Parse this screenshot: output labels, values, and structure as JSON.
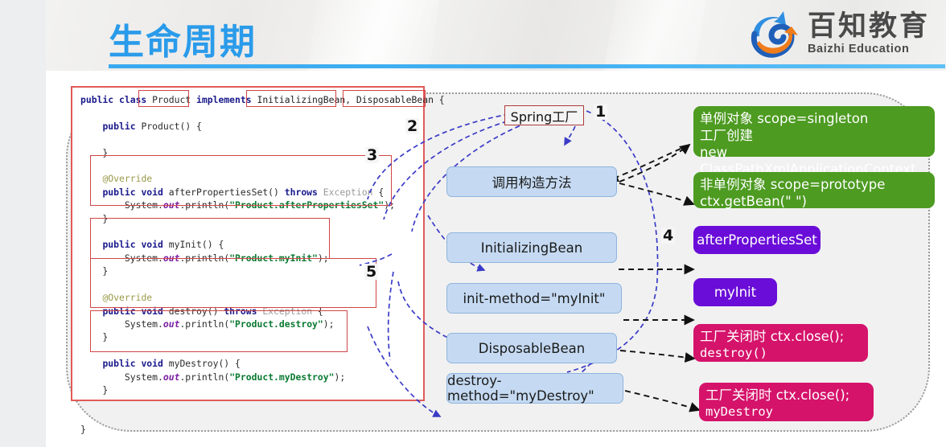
{
  "header": {
    "title": "生命周期",
    "logo": {
      "cn": "百知教育",
      "en": "Baizhi Education",
      "icon": "baizhi-logo-icon"
    },
    "accent_color": "#2a9bea"
  },
  "code_panel": {
    "lines": [
      "public class Product implements InitializingBean, DisposableBean {",
      "",
      "    public Product() {",
      "",
      "    }",
      "",
      "    @Override",
      "    public void afterPropertiesSet() throws Exception {",
      "        System.out.println(\"Product.afterPropertiesSet\");",
      "    }",
      "",
      "    public void myInit() {",
      "        System.out.println(\"Product.myInit\");",
      "    }",
      "",
      "    @Override",
      "    public void destroy() throws Exception {",
      "        System.out.println(\"Product.destroy\");",
      "    }",
      "",
      "    public void myDestroy() {",
      "        System.out.println(\"Product.myDestroy\");",
      "    }",
      "",
      "",
      "}"
    ],
    "highlights": [
      "Product",
      "InitializingBean",
      "DisposableBean",
      "afterPropertiesSet-method",
      "myInit-method",
      "destroy-method",
      "myDestroy-method"
    ],
    "border_color": "#e05a5a",
    "highlight_color": "#d14545"
  },
  "flow": {
    "source_label": "Spring工厂",
    "boxes": [
      {
        "label": "调用构造方法"
      },
      {
        "label": "InitializingBean"
      },
      {
        "label": "init-method=\"myInit\""
      },
      {
        "label": "DisposableBean"
      },
      {
        "label": "destroy-method=\"myDestroy\""
      }
    ],
    "box_color": "#c5daf2"
  },
  "annotations": [
    {
      "color": "green",
      "hex": "#4d9b21",
      "lines": [
        "单例对象 scope=singleton",
        "工厂创建",
        "new ClassPathXmlApplicationContext"
      ]
    },
    {
      "color": "green",
      "hex": "#4d9b21",
      "lines": [
        "非单例对象 scope=prototype",
        "ctx.getBean(\"  \")"
      ]
    },
    {
      "color": "purple",
      "hex": "#6a0dd8",
      "lines": [
        "afterPropertiesSet"
      ]
    },
    {
      "color": "purple",
      "hex": "#6a0dd8",
      "lines": [
        "myInit"
      ]
    },
    {
      "color": "pink",
      "hex": "#d5136b",
      "lines": [
        "工厂关闭时 ctx.close();",
        "destroy()"
      ]
    },
    {
      "color": "pink",
      "hex": "#d5136b",
      "lines": [
        "工厂关闭时 ctx.close();",
        "myDestroy"
      ]
    }
  ],
  "step_numbers": [
    "1",
    "2",
    "3",
    "4",
    "5"
  ]
}
